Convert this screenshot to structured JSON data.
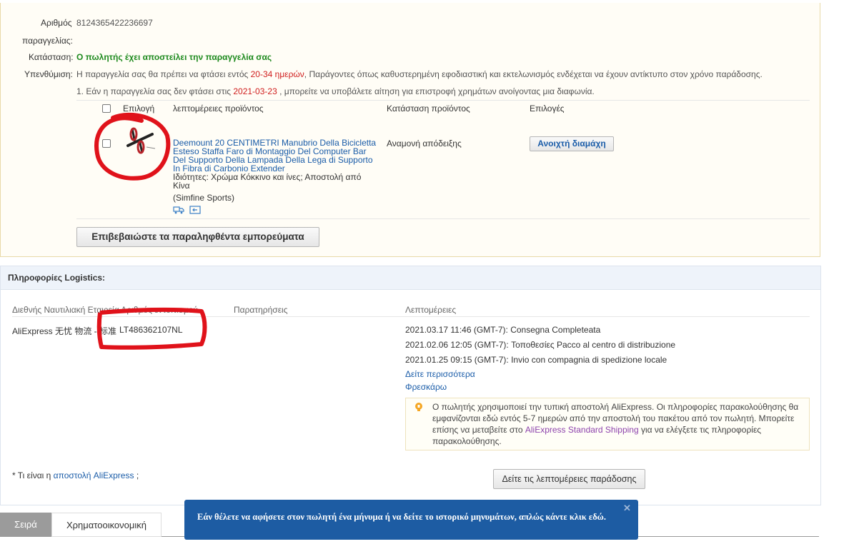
{
  "order": {
    "number_label": "Αριθμός παραγγελίας:",
    "number_value": "8124365422236697",
    "status_label": "Κατάσταση:",
    "status_value": "Ο πωλητής έχει αποστείλει την παραγγελία σας",
    "reminder_label": "Υπενθύμιση:",
    "reminder_text_1": "Η παραγγελία σας θα πρέπει να φτάσει εντός ",
    "reminder_days": "20-34 ημερών",
    "reminder_text_2": ", Παράγοντες όπως καθυστερημένη εφοδιαστική και εκτελωνισμός ενδέχεται να έχουν αντίκτυπο στον χρόνο παράδοσης.",
    "note_text_1": "1. Εάν η παραγγελία σας δεν φτάσει στις ",
    "note_date": "2021-03-23",
    "note_text_2": " , μπορείτε να υποβάλετε αίτηση για επιστροφή χρημάτων ανοίγοντας μια διαφωνία."
  },
  "table": {
    "col_select": "Επιλογή",
    "col_details": "λεπτομέρειες προϊόντος",
    "col_status": "Κατάσταση προϊόντος",
    "col_options": "Επιλογές"
  },
  "product": {
    "title": "Deemount 20 CENTIMETRI Manubrio Della Bicicletta Esteso Staffa Faro di Montaggio Del Computer Bar Del Supporto Della Lampada Della Lega di Supporto In Fibra di Carbonio Extender",
    "properties": "Ιδιότητες: Χρώμα Κόκκινο και ίνες; Αποστολή από Κίνα",
    "store": "(Simfine Sports)",
    "status": "Αναμονή απόδειξης",
    "dispute_button": "Ανοιχτή διαμάχη",
    "icons": [
      "truck-icon",
      "return-icon"
    ]
  },
  "confirm_button": "Επιβεβαιώστε τα παραληφθέντα εμπορεύματα",
  "logistics": {
    "header": "Πληροφορίες Logistics:",
    "col_tracking": "Διεθνής Ναυτιλιακή Εταιρεία Αριθμός εντοπισμού",
    "col_remarks": "Παρατηρήσεις",
    "col_details": "Λεπτομέρειες",
    "carrier": "AliExpress 无忧 物流 - 标准",
    "tracking_number": "LT486362107NL",
    "events": [
      "2021.03.17 11:46 (GMT-7): Consegna Completeata",
      "2021.02.06 12:05 (GMT-7): Τοποθεσίες Pacco al centro di distribuzione",
      "2021.01.25 09:15 (GMT-7): Invio con compagnia di spedizione locale"
    ],
    "see_more": "Δείτε περισσότερα",
    "refresh": "Φρεσκάρω",
    "tip_1": "Ο πωλητής χρησιμοποιεί την τυπική αποστολή AliExpress. Οι πληροφορίες παρακολούθησης θα εμφανίζονται εδώ εντός 5-7 ημερών από την αποστολή του πακέτου από τον πωλητή. Μπορείτε επίσης να μεταβείτε στο ",
    "tip_link": "AliExpress Standard Shipping",
    "tip_2": " για να ελέγξετε τις πληροφορίες παρακολούθησης.",
    "footnote_1": "* Τι είναι η ",
    "footnote_link": "αποστολή AliExpress",
    "footnote_2": " ;",
    "delivery_button": "Δείτε τις λεπτομέρειες παράδοσης"
  },
  "tabs": [
    "Σειρά",
    "Χρηματοοικονομική"
  ],
  "chat_message": "Εάν θέλετε να αφήσετε στον πωλητή ένα μήνυμα ή να δείτε το ιστορικό μηνυμάτων, απλώς κάντε κλικ εδώ.",
  "colors": {
    "status_green": "#1e8a1e",
    "highlight_red": "#d01e1e",
    "link_blue": "#1a5ca8",
    "chat_blue": "#1d5ca3",
    "annotation_red": "#e0121a"
  }
}
